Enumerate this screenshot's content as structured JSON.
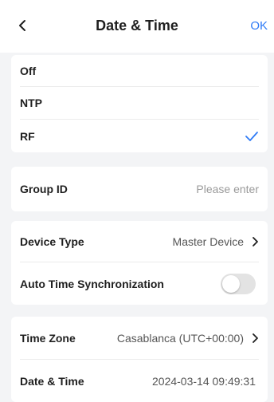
{
  "header": {
    "title": "Date & Time",
    "ok_label": "OK"
  },
  "sync_mode": {
    "options": [
      {
        "label": "Off",
        "selected": false
      },
      {
        "label": "NTP",
        "selected": false
      },
      {
        "label": "RF",
        "selected": true
      }
    ]
  },
  "group_id": {
    "label": "Group ID",
    "value": "",
    "placeholder": "Please enter"
  },
  "device": {
    "type_label": "Device Type",
    "type_value": "Master Device",
    "auto_sync_label": "Auto Time Synchronization",
    "auto_sync_on": false
  },
  "time": {
    "zone_label": "Time Zone",
    "zone_value": "Casablanca (UTC+00:00)",
    "datetime_label": "Date & Time",
    "datetime_value": "2024-03-14 09:49:31"
  },
  "colors": {
    "accent": "#2f7bf6",
    "background": "#f3f4f6",
    "toggle_off": "#e3e3e3"
  },
  "icons": {
    "back": "chevron-left-icon",
    "selected": "checkmark-icon",
    "navigate": "chevron-right-icon"
  }
}
